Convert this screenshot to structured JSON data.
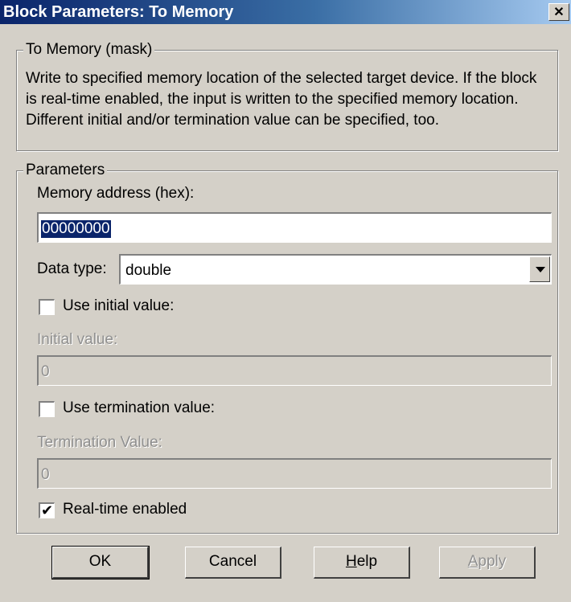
{
  "window": {
    "title": "Block Parameters: To Memory",
    "close_glyph": "✕"
  },
  "mask_group": {
    "legend": "To Memory (mask)",
    "description": "Write to specified memory location of the selected target device.  If the block is real-time enabled, the input is written to the specified memory location.  Different initial and/or termination value can be specified, too."
  },
  "params": {
    "legend": "Parameters",
    "memory_address_label": "Memory address (hex):",
    "memory_address_value": "00000000",
    "data_type_label": "Data type:",
    "data_type_value": "double",
    "use_initial_label": "Use initial value:",
    "use_initial_checked": false,
    "initial_value_label": "Initial value:",
    "initial_value": "0",
    "use_termination_label": "Use termination value:",
    "use_termination_checked": false,
    "termination_value_label": "Termination Value:",
    "termination_value": "0",
    "realtime_label": "Real-time enabled",
    "realtime_checked": true,
    "check_glyph": "✔"
  },
  "buttons": {
    "ok": "OK",
    "cancel": "Cancel",
    "help_mnemonic": "H",
    "help_rest": "elp",
    "apply_mnemonic": "A",
    "apply_rest": "pply"
  }
}
